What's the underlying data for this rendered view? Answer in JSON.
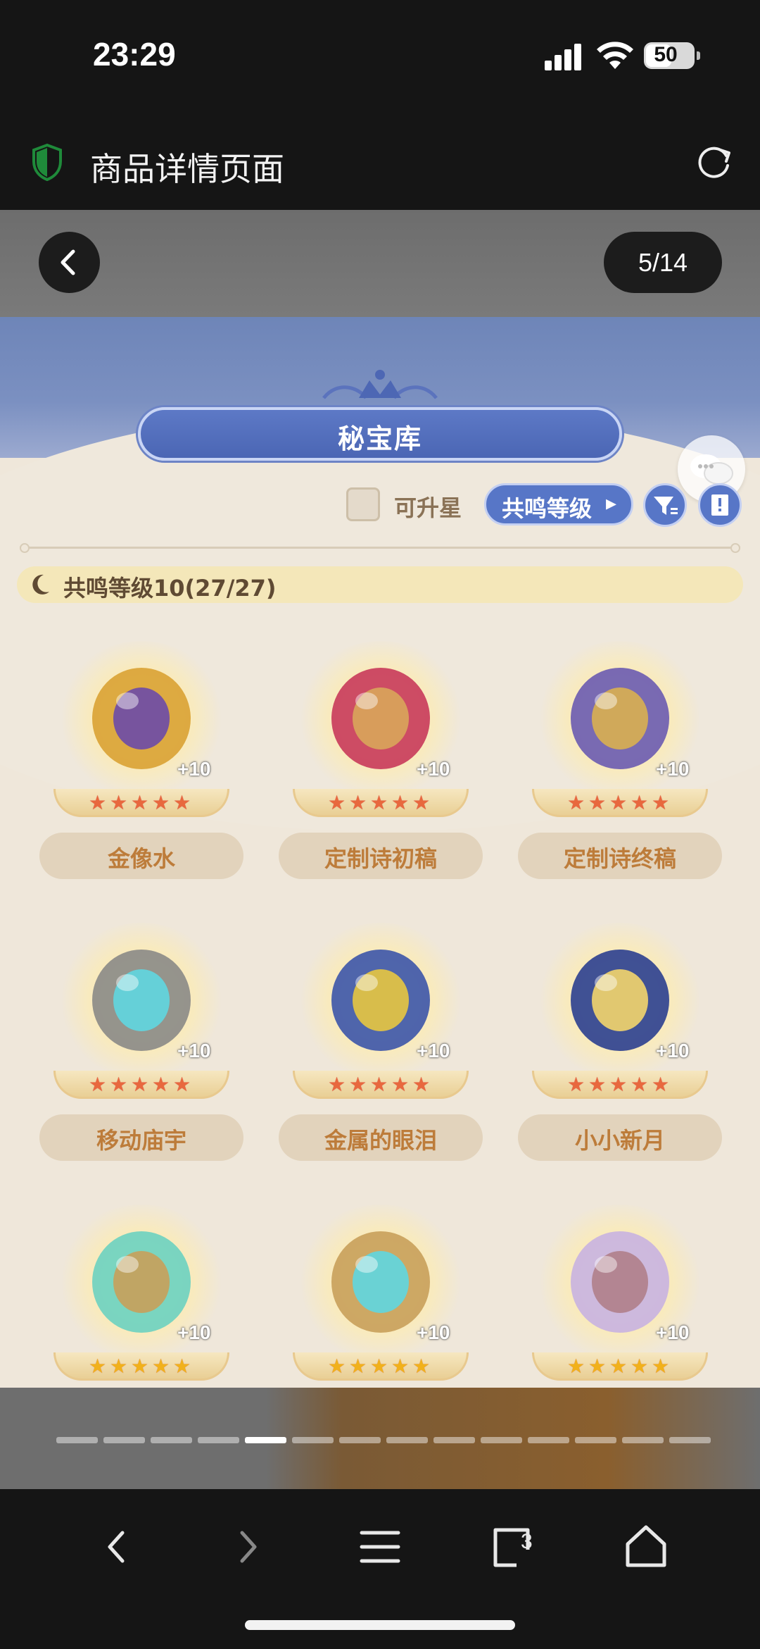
{
  "status_bar": {
    "time": "23:29",
    "battery": "50"
  },
  "title_bar": {
    "title": "商品详情页面",
    "shield_color": "#1f8a3a"
  },
  "viewer": {
    "page_indicator": "5/14",
    "current_page": 5,
    "total_pages": 14
  },
  "game": {
    "banner_title": "秘宝库",
    "upgradable_label": "可升星",
    "sort_label": "共鸣等级",
    "level_header": "共鸣等级10(27/27)",
    "items": [
      {
        "name": "金像水",
        "bonus": "+10",
        "stars": 5,
        "star_color": "red"
      },
      {
        "name": "定制诗初稿",
        "bonus": "+10",
        "stars": 5,
        "star_color": "red"
      },
      {
        "name": "定制诗终稿",
        "bonus": "+10",
        "stars": 5,
        "star_color": "red"
      },
      {
        "name": "移动庙宇",
        "bonus": "+10",
        "stars": 5,
        "star_color": "red"
      },
      {
        "name": "金属的眼泪",
        "bonus": "+10",
        "stars": 5,
        "star_color": "red"
      },
      {
        "name": "小小新月",
        "bonus": "+10",
        "stars": 5,
        "star_color": "red"
      },
      {
        "name": "",
        "bonus": "+10",
        "stars": 5,
        "star_color": "gold"
      },
      {
        "name": "",
        "bonus": "+10",
        "stars": 5,
        "star_color": "gold"
      },
      {
        "name": "",
        "bonus": "+10",
        "stars": 5,
        "star_color": "gold"
      }
    ]
  },
  "bottom_nav": {
    "tabs_count": "3"
  }
}
